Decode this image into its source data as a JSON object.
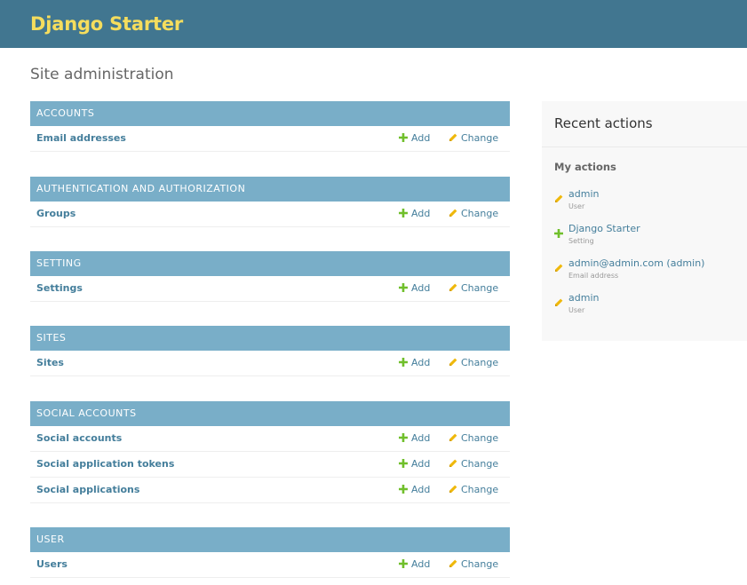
{
  "header": {
    "site_name": "Django Starter",
    "brand_color": "#f5dd5d",
    "bar_color": "#417690"
  },
  "page": {
    "title": "Site administration"
  },
  "labels": {
    "add": "Add",
    "change": "Change"
  },
  "apps": [
    {
      "name": "Accounts",
      "models": [
        {
          "name": "Email addresses"
        }
      ]
    },
    {
      "name": "Authentication and Authorization",
      "models": [
        {
          "name": "Groups"
        }
      ]
    },
    {
      "name": "Setting",
      "models": [
        {
          "name": "Settings"
        }
      ]
    },
    {
      "name": "Sites",
      "models": [
        {
          "name": "Sites"
        }
      ]
    },
    {
      "name": "Social Accounts",
      "models": [
        {
          "name": "Social accounts"
        },
        {
          "name": "Social application tokens"
        },
        {
          "name": "Social applications"
        }
      ]
    },
    {
      "name": "User",
      "models": [
        {
          "name": "Users"
        }
      ]
    }
  ],
  "sidebar": {
    "title": "Recent actions",
    "subtitle": "My actions",
    "actions": [
      {
        "icon": "pencil-icon",
        "label": "admin",
        "type": "User"
      },
      {
        "icon": "plus-icon",
        "label": "Django Starter",
        "type": "Setting"
      },
      {
        "icon": "pencil-icon",
        "label": "admin@admin.com (admin)",
        "type": "Email address"
      },
      {
        "icon": "pencil-icon",
        "label": "admin",
        "type": "User"
      }
    ]
  },
  "colors": {
    "caption_bg": "#79aec8",
    "link": "#447e9b",
    "add_icon": "#70bf2b",
    "change_icon": "#efb80b"
  }
}
